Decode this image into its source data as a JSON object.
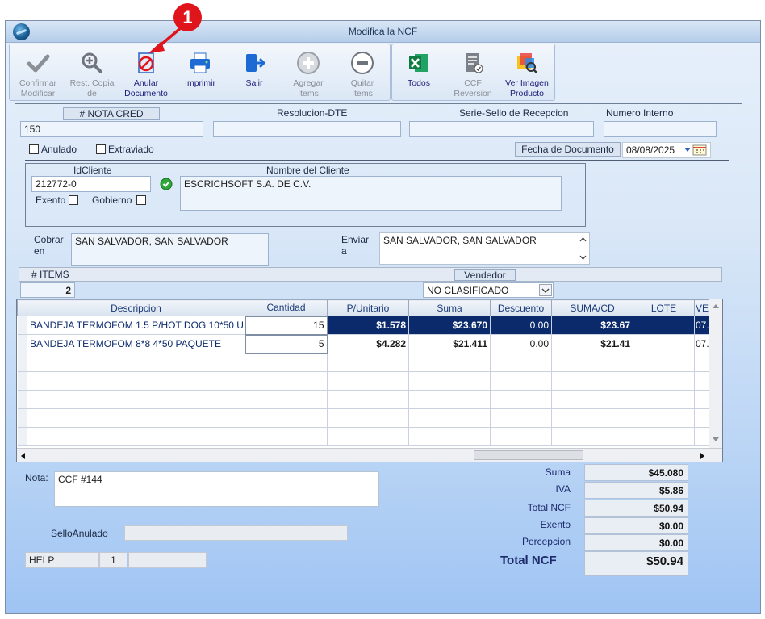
{
  "window": {
    "title": "Modifica la NCF"
  },
  "annotation": {
    "number": "1"
  },
  "toolbar": {
    "buttons": [
      {
        "label1": "Confirmar",
        "label2": "Modificar",
        "icon": "checkmark-icon",
        "enabled": false
      },
      {
        "label1": "Rest. Copia",
        "label2": "de",
        "icon": "zoom-in-icon",
        "enabled": false
      },
      {
        "label1": "Anular",
        "label2": "Documento",
        "icon": "cancel-document-icon",
        "enabled": true
      },
      {
        "label1": "Imprimir",
        "label2": "",
        "icon": "printer-icon",
        "enabled": true
      },
      {
        "label1": "Salir",
        "label2": "",
        "icon": "exit-icon",
        "enabled": true
      },
      {
        "label1": "Agregar",
        "label2": "Items",
        "icon": "add-circle-icon",
        "enabled": false
      },
      {
        "label1": "Quitar",
        "label2": "Items",
        "icon": "remove-circle-icon",
        "enabled": false
      }
    ],
    "buttons2": [
      {
        "label1": "Todos",
        "label2": "",
        "icon": "excel-icon"
      },
      {
        "label1": "CCF",
        "label2": "Reversion",
        "icon": "document-check-icon"
      },
      {
        "label1": "Ver Imagen",
        "label2": "Producto",
        "icon": "product-image-icon"
      }
    ]
  },
  "header": {
    "nota_label": "# NOTA CRED",
    "nota_value": "150",
    "resolucion_label": "Resolucion-DTE",
    "resolucion_value": "",
    "serie_label": "Serie-Sello de Recepcion",
    "serie_value": "",
    "numero_label": "Numero Interno",
    "numero_value": ""
  },
  "flags": {
    "anulado": "Anulado",
    "extraviado": "Extraviado"
  },
  "fecha": {
    "label": "Fecha de  Documento",
    "value": "08/08/2025"
  },
  "cliente": {
    "id_label": "IdCliente",
    "id_value": "212772-0",
    "nombre_label": "Nombre del Cliente",
    "nombre_value": "ESCRICHSOFT S.A. DE C.V.",
    "exento_label": "Exento",
    "gobierno_label": "Gobierno"
  },
  "cobrar": {
    "label1": "Cobrar",
    "label2": "en",
    "value": "SAN SALVADOR, SAN SALVADOR"
  },
  "enviar": {
    "label1": "Enviar",
    "label2": "a",
    "value": "SAN SALVADOR, SAN SALVADOR"
  },
  "items_count": {
    "label": "# ITEMS",
    "value": "2"
  },
  "vendedor": {
    "label": "Vendedor",
    "value": "NO CLASIFICADO"
  },
  "grid": {
    "columns": [
      "Descripcion",
      "Cantidad",
      "P/Unitario",
      "Suma",
      "Descuento",
      "SUMA/CD",
      "LOTE",
      "VE"
    ],
    "rows": [
      [
        "BANDEJA TERMOFOM 1.5 P/HOT DOG 10*50 U",
        "15",
        "$1.578",
        "$23.670",
        "0.00",
        "$23.67",
        "",
        "07."
      ],
      [
        "BANDEJA TERMOFOM 8*8 4*50 PAQUETE",
        "5",
        "$4.282",
        "$21.411",
        "0.00",
        "$21.41",
        "",
        "07."
      ]
    ]
  },
  "nota": {
    "label": "Nota:",
    "value": "CCF  #144"
  },
  "sello": {
    "label": "SelloAnulado",
    "value": ""
  },
  "status": {
    "help": "HELP",
    "num": "1",
    "extra": ""
  },
  "totals": {
    "suma_label": "Suma",
    "suma": "$45.080",
    "iva_label": "IVA",
    "iva": "$5.86",
    "total_label": "Total NCF",
    "total": "$50.94",
    "exento_label": "Exento",
    "exento": "$0.00",
    "percepcion_label": "Percepcion",
    "percepcion": "$0.00",
    "grand_label": "Total NCF",
    "grand": "$50.94"
  },
  "colors": {
    "selected_row": "#0b2a6b",
    "annotation": "#e0141b",
    "accent": "#1c2a6a"
  }
}
